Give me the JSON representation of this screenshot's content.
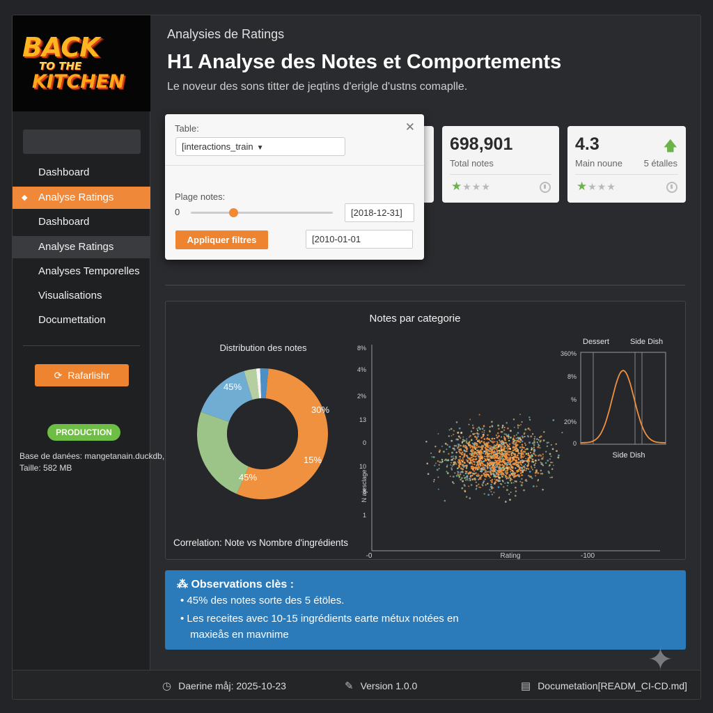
{
  "logo": {
    "line1": "BACK",
    "line2": "TO THE",
    "line3": "KITCHEN"
  },
  "sidebar": {
    "items": [
      {
        "label": "Dashboard"
      },
      {
        "label": "Analyse Ratings"
      },
      {
        "label": "Dashboard"
      },
      {
        "label": "Analyse Ratings"
      },
      {
        "label": "Analyses Temporelles"
      },
      {
        "label": "Visualisations"
      },
      {
        "label": "Documettation"
      }
    ],
    "refresh_label": "Rafarlishr",
    "badge": "PRODUCTION",
    "db_line": "Base de danées: mangetanain.duckdb,",
    "size_line": "Taille: 582 MB"
  },
  "header": {
    "breadcrumb": "Analysies de Ratings",
    "title": "H1 Analyse des Notes et Comportements",
    "subtitle": "Le noveur des sons titter de jeqtins d'erigle d'ustns comaplle."
  },
  "filters": {
    "table_label": "Table:",
    "table_value": "[interactions_train",
    "range_label": "Plage notes:",
    "range_min": "0",
    "slider_level": 0.3,
    "date_end": "[2018-12-31]",
    "date_start": "[2010-01-01",
    "apply_label": "Appliquer filtres"
  },
  "cards": [
    {
      "value": "698,901",
      "label": "Total notes",
      "stars_filled": 1,
      "stars_total": 4
    },
    {
      "value": "4.3",
      "label": "Main noune",
      "label2": "5 étalles",
      "stars_filled": 1,
      "stars_total": 4
    }
  ],
  "charts": {
    "panel_title": "Notes par categorie",
    "donut_title": "Distribution des notes",
    "scatter_footer": "Correlation: Note vs Nombre d'ingrédients",
    "density_labels": {
      "left": "Dessert",
      "right": "Side Dish",
      "bottom": "Side Dish"
    }
  },
  "chart_data": [
    {
      "type": "pie",
      "title": "Distribution des notes",
      "slices": [
        {
          "label": "30%",
          "value": 55,
          "color": "#f0913f"
        },
        {
          "label": "45%",
          "value": 24,
          "color": "#9cc488"
        },
        {
          "label": "45%",
          "value": 15,
          "color": "#71add3"
        },
        {
          "label": "",
          "value": 3,
          "color": "#b6cfa1"
        },
        {
          "label": "",
          "value": 1,
          "color": "#f5f5f5"
        },
        {
          "label": "",
          "value": 2,
          "color": "#4d8fc4"
        }
      ],
      "extra_labels": [
        "15%"
      ]
    },
    {
      "type": "scatter",
      "title": "Notes par categorie",
      "xlabel": "Rating",
      "ylabel": "N ajesclage",
      "xticks": [
        "-0",
        "-100"
      ],
      "yticks": [
        "8%",
        "4%",
        "2%",
        "13",
        "0",
        "10",
        "8",
        "1"
      ],
      "colors": [
        "#f0913f",
        "#9cc488",
        "#71add3",
        "#e8d3a0"
      ],
      "center": [
        0.5,
        0.47
      ],
      "spread": [
        0.19,
        0.17
      ],
      "n_points": 1500
    },
    {
      "type": "line",
      "xlabel": "Side Dish",
      "yticks": [
        "360%",
        "8%",
        "%",
        "20%",
        "0"
      ],
      "series_labels": [
        "Dessert",
        "Side Dish"
      ],
      "peak": 0.35,
      "color": "#f0913f"
    }
  ],
  "observations": {
    "title": "Observations clès :",
    "bullet1": "45% des notes sorte des 5 étöles.",
    "bullet2a": "Les receites avec 10-15 ingrédients earte métux notées en",
    "bullet2b": "maxieås en mavnime"
  },
  "footer": {
    "updated": "Daerine måj: 2025-10-23",
    "version": "Version 1.0.0",
    "docs": "Documetation[READM_CI-CD.md]"
  }
}
